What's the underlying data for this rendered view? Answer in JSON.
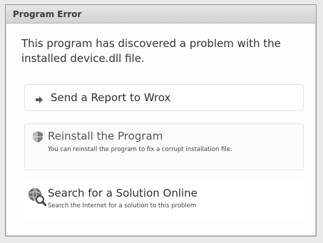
{
  "dialog": {
    "title": "Program Error",
    "message": "This program has discovered a problem with the installed device.dll file."
  },
  "options": [
    {
      "title": "Send a Report to Wrox",
      "icon": "arrow-right-icon"
    },
    {
      "title": "Reinstall the Program",
      "subtitle": "You can reinstall the program to fix a corrupt installation file.",
      "icon": "shield-icon"
    },
    {
      "title": "Search for a Solution Online",
      "subtitle": "Search the Internet for a solution to this problem",
      "icon": "globe-search-icon"
    }
  ]
}
